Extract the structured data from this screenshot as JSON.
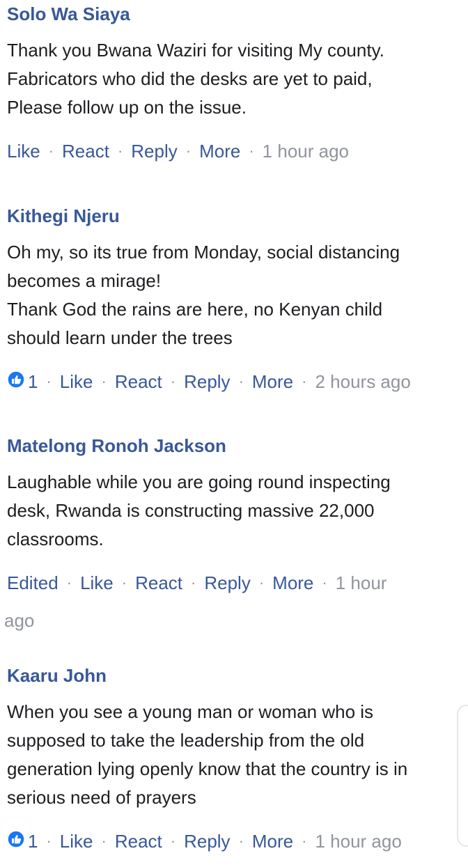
{
  "comments": [
    {
      "author": "Solo Wa Siaya",
      "lines": [
        "Thank you Bwana Waziri for visiting My county.",
        "Fabricators who did the desks are yet to paid,",
        "Please follow up on the issue."
      ],
      "actions": {
        "like": "Like",
        "react": "React",
        "reply": "Reply",
        "more": "More",
        "time": "1 hour ago"
      }
    },
    {
      "author": "Kithegi Njeru",
      "lines": [
        "Oh my,  so its true from Monday,  social distancing",
        "becomes a mirage!",
        "Thank God the rains are here, no Kenyan child",
        "should learn under the trees"
      ],
      "reaction_count": "1",
      "actions": {
        "like": "Like",
        "react": "React",
        "reply": "Reply",
        "more": "More",
        "time": "2 hours ago"
      }
    },
    {
      "author": "Matelong Ronoh Jackson",
      "lines": [
        "Laughable while you are going round inspecting",
        "desk, Rwanda is constructing massive 22,000",
        "classrooms."
      ],
      "edited": "Edited",
      "actions": {
        "like": "Like",
        "react": "React",
        "reply": "Reply",
        "more": "More",
        "time_part1": "1 hour",
        "time_part2": "ago"
      }
    },
    {
      "author": "Kaaru John",
      "lines": [
        "When you see a young man or woman who is",
        "supposed to take the leadership from the old",
        "generation lying openly know that the country is in",
        "serious need of prayers"
      ],
      "reaction_count": "1",
      "actions": {
        "like": "Like",
        "react": "React",
        "reply": "Reply",
        "more": "More",
        "time": "1 hour ago"
      }
    }
  ],
  "colors": {
    "link": "#385898",
    "meta": "#90949c",
    "text": "#1c1e21",
    "like_icon": "#1877f2"
  },
  "icons": {
    "reaction": "thumbs-up-icon"
  }
}
